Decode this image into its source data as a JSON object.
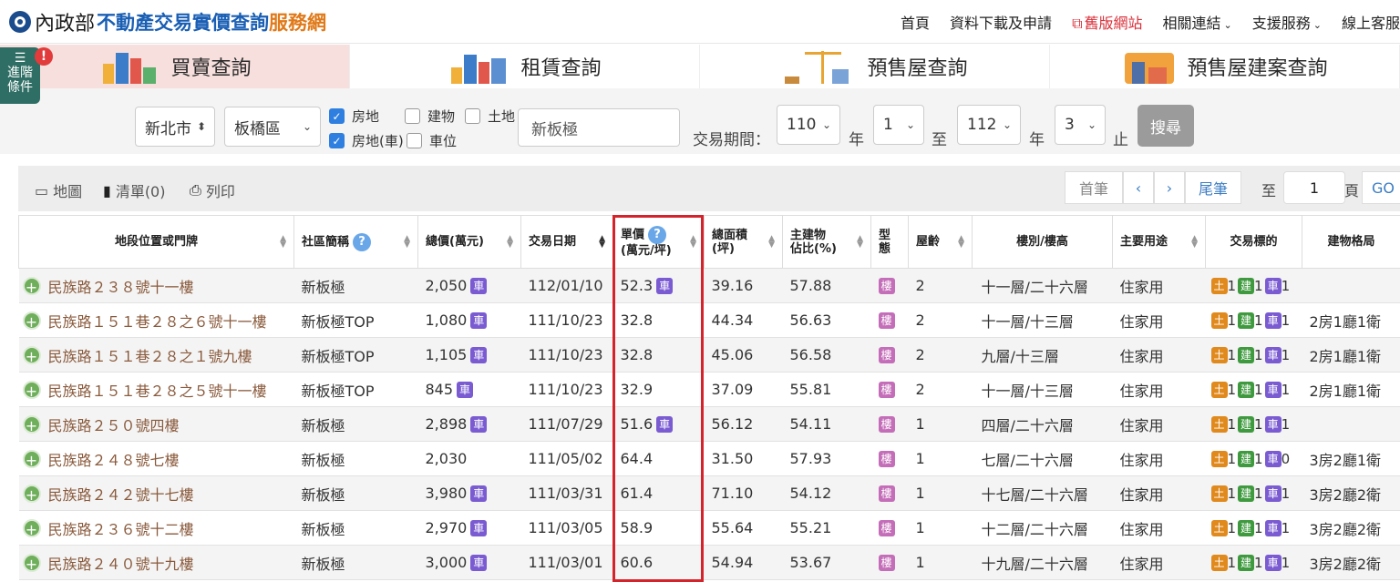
{
  "header": {
    "logo_ministry": "內政部",
    "logo_main": "不動產交易實價查詢",
    "logo_accent": "服務網",
    "nav": [
      {
        "label": "首頁",
        "red": false,
        "caret": false
      },
      {
        "label": "資料下載及申請",
        "red": false,
        "caret": false
      },
      {
        "label": "舊版網站",
        "red": true,
        "caret": false
      },
      {
        "label": "相關連結",
        "red": false,
        "caret": true
      },
      {
        "label": "支援服務",
        "red": false,
        "caret": true
      },
      {
        "label": "線上客服",
        "red": false,
        "caret": false
      }
    ]
  },
  "categories": [
    "買賣查詢",
    "租賃查詢",
    "預售屋查詢",
    "預售屋建案查詢"
  ],
  "advanced": {
    "label1": "進階",
    "label2": "條件",
    "badge": "!"
  },
  "filter": {
    "city": "新北市",
    "district": "板橋區",
    "checks": {
      "house_land": "房地",
      "building": "建物",
      "land": "土地",
      "house_land_car": "房地(車)",
      "parking": "車位"
    },
    "keyword": "新板極",
    "period_label": "交易期間：",
    "from_year": "110",
    "from_month": "1",
    "to_year": "112",
    "to_month": "3",
    "year_unit": "年",
    "to_label": "至",
    "stop_label": "止",
    "search": "搜尋"
  },
  "toolbar": {
    "map": "地圖",
    "list": "清單(0)",
    "print": "列印",
    "first": "首筆",
    "prev": "‹",
    "next": "›",
    "last": "尾筆",
    "to": "至",
    "page": "1",
    "page_unit": "頁",
    "go": "GO"
  },
  "table": {
    "headers": {
      "location": "地段位置或門牌",
      "community": "社區簡稱",
      "total": "總價(萬元)",
      "date": "交易日期",
      "unit_price_1": "單價",
      "unit_price_2": "(萬元/坪)",
      "area_1": "總面積",
      "area_2": "(坪)",
      "main_1": "主建物",
      "main_2": "佔比(%)",
      "type": "型態",
      "age": "屋齡",
      "floor": "樓別/樓高",
      "use": "主要用途",
      "target": "交易標的",
      "layout": "建物格局"
    },
    "tag_car": "車",
    "tag_lou": "樓",
    "tag_land": "土",
    "tag_bld": "建",
    "rows": [
      {
        "addr": "民族路２３８號十一樓",
        "comm": "新板極",
        "total": "2,050",
        "total_car": true,
        "date": "112/01/10",
        "price": "52.3",
        "price_car": true,
        "area": "39.16",
        "ratio": "57.88",
        "age": "2",
        "floor": "十一層/二十六層",
        "use": "住家用",
        "land": "1",
        "bld": "1",
        "car": "1",
        "layout": ""
      },
      {
        "addr": "民族路１５１巷２８之６號十一樓",
        "comm": "新板極TOP",
        "total": "1,080",
        "total_car": true,
        "date": "111/10/23",
        "price": "32.8",
        "price_car": false,
        "area": "44.34",
        "ratio": "56.63",
        "age": "2",
        "floor": "十一層/十三層",
        "use": "住家用",
        "land": "1",
        "bld": "1",
        "car": "1",
        "layout": "2房1廳1衛"
      },
      {
        "addr": "民族路１５１巷２８之１號九樓",
        "comm": "新板極TOP",
        "total": "1,105",
        "total_car": true,
        "date": "111/10/23",
        "price": "32.8",
        "price_car": false,
        "area": "45.06",
        "ratio": "56.58",
        "age": "2",
        "floor": "九層/十三層",
        "use": "住家用",
        "land": "1",
        "bld": "1",
        "car": "1",
        "layout": "2房1廳1衛"
      },
      {
        "addr": "民族路１５１巷２８之５號十一樓",
        "comm": "新板極TOP",
        "total": "845",
        "total_car": true,
        "date": "111/10/23",
        "price": "32.9",
        "price_car": false,
        "area": "37.09",
        "ratio": "55.81",
        "age": "2",
        "floor": "十一層/十三層",
        "use": "住家用",
        "land": "1",
        "bld": "1",
        "car": "1",
        "layout": "2房1廳1衛"
      },
      {
        "addr": "民族路２５０號四樓",
        "comm": "新板極",
        "total": "2,898",
        "total_car": true,
        "date": "111/07/29",
        "price": "51.6",
        "price_car": true,
        "area": "56.12",
        "ratio": "54.11",
        "age": "1",
        "floor": "四層/二十六層",
        "use": "住家用",
        "land": "1",
        "bld": "1",
        "car": "1",
        "layout": ""
      },
      {
        "addr": "民族路２４８號七樓",
        "comm": "新板極",
        "total": "2,030",
        "total_car": false,
        "date": "111/05/02",
        "price": "64.4",
        "price_car": false,
        "area": "31.50",
        "ratio": "57.93",
        "age": "1",
        "floor": "七層/二十六層",
        "use": "住家用",
        "land": "1",
        "bld": "1",
        "car": "0",
        "layout": "3房2廳1衛"
      },
      {
        "addr": "民族路２４２號十七樓",
        "comm": "新板極",
        "total": "3,980",
        "total_car": true,
        "date": "111/03/31",
        "price": "61.4",
        "price_car": false,
        "area": "71.10",
        "ratio": "54.12",
        "age": "1",
        "floor": "十七層/二十六層",
        "use": "住家用",
        "land": "1",
        "bld": "1",
        "car": "1",
        "layout": "3房2廳2衛"
      },
      {
        "addr": "民族路２３６號十二樓",
        "comm": "新板極",
        "total": "2,970",
        "total_car": true,
        "date": "111/03/05",
        "price": "58.9",
        "price_car": false,
        "area": "55.64",
        "ratio": "55.21",
        "age": "1",
        "floor": "十二層/二十六層",
        "use": "住家用",
        "land": "1",
        "bld": "1",
        "car": "1",
        "layout": "3房2廳2衛"
      },
      {
        "addr": "民族路２４０號十九樓",
        "comm": "新板極",
        "total": "3,000",
        "total_car": true,
        "date": "111/03/01",
        "price": "60.6",
        "price_car": false,
        "area": "54.94",
        "ratio": "53.67",
        "age": "1",
        "floor": "十九層/二十六層",
        "use": "住家用",
        "land": "1",
        "bld": "1",
        "car": "1",
        "layout": "3房2廳2衛"
      }
    ]
  }
}
